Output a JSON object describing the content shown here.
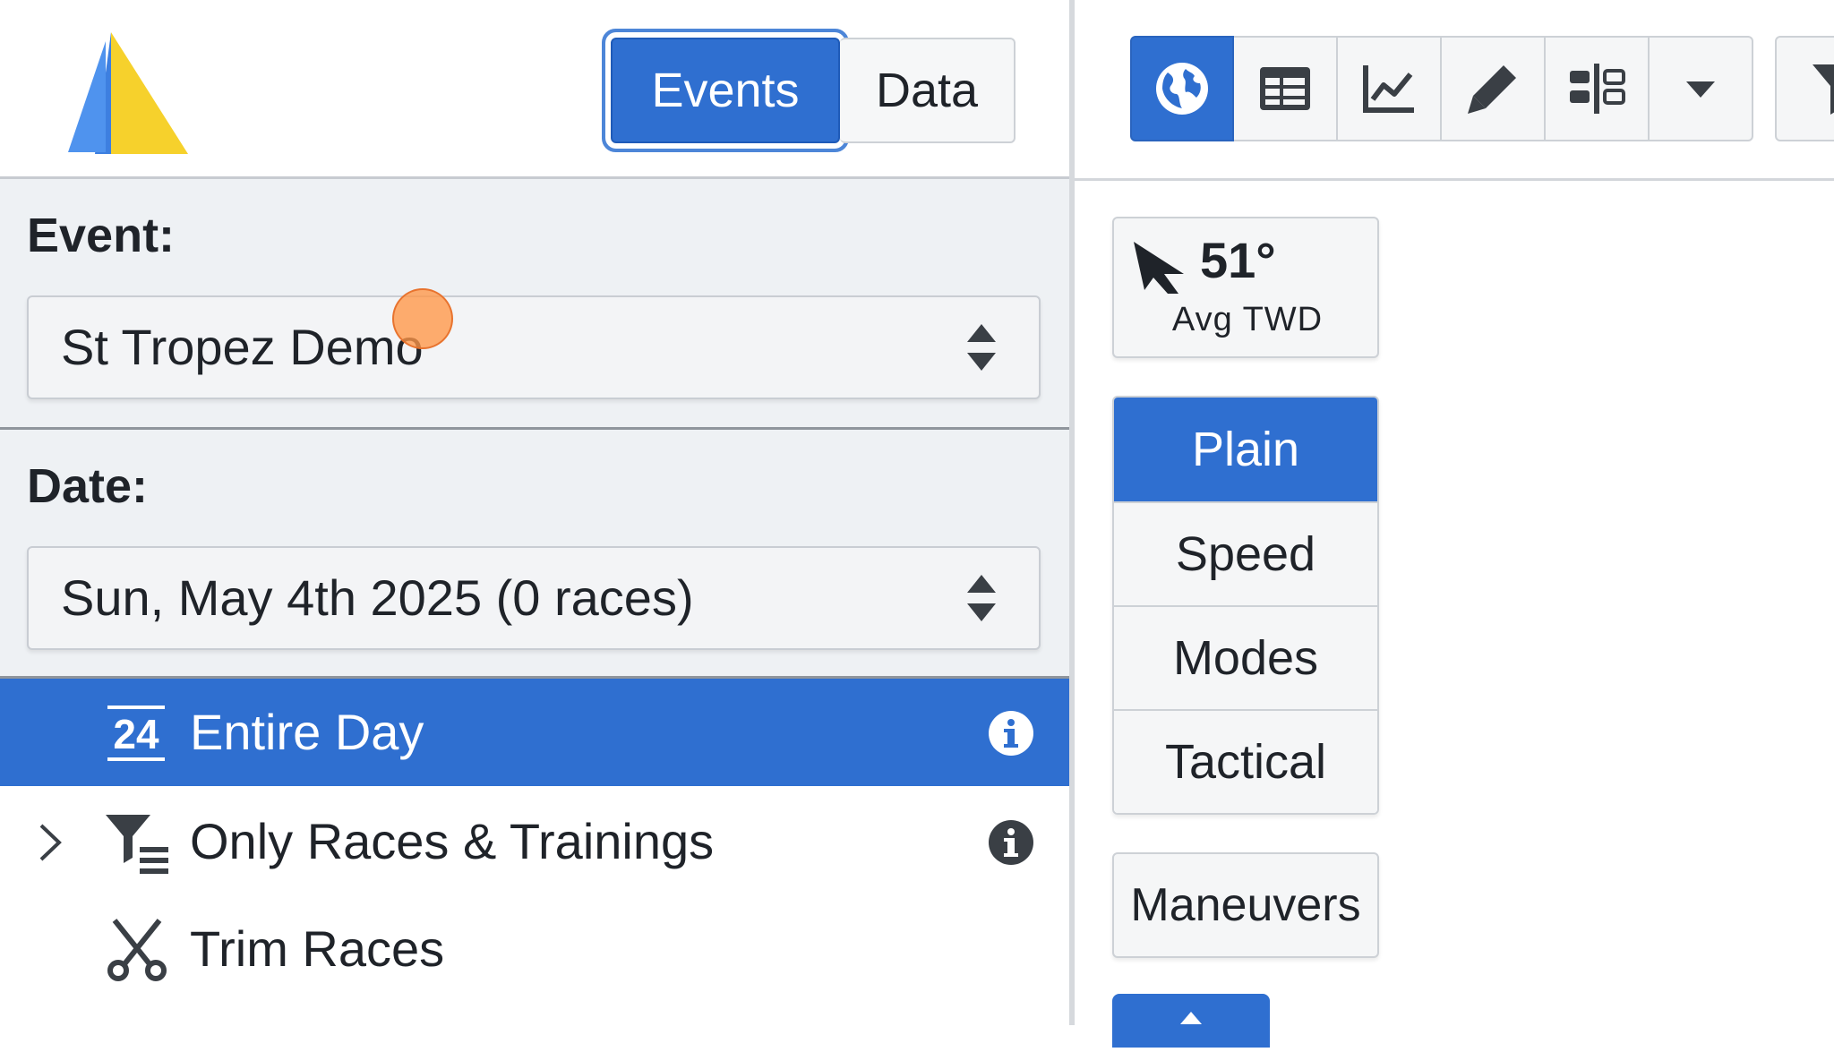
{
  "header": {
    "mode_toggle": {
      "events_label": "Events",
      "data_label": "Data",
      "active": "Events"
    }
  },
  "event_selector": {
    "label": "Event:",
    "selected": "St Tropez Demo"
  },
  "date_selector": {
    "label": "Date:",
    "selected": "Sun, May 4th 2025 (0 races)"
  },
  "tree": {
    "items": [
      {
        "label": "Entire Day",
        "icon": "calendar-24-icon",
        "badge": "24",
        "selected": true,
        "info": true
      },
      {
        "label": "Only Races & Trainings",
        "icon": "filter-list-icon",
        "expandable": true,
        "info": true
      },
      {
        "label": "Trim Races",
        "icon": "scissors-icon"
      }
    ]
  },
  "toolbar": {
    "buttons": [
      {
        "name": "map-view",
        "icon": "globe-icon",
        "active": true
      },
      {
        "name": "table-view",
        "icon": "table-icon"
      },
      {
        "name": "chart-view",
        "icon": "line-chart-icon"
      },
      {
        "name": "edit",
        "icon": "pencil-icon"
      },
      {
        "name": "layout",
        "icon": "columns-icon"
      },
      {
        "name": "more",
        "icon": "caret-down-icon"
      }
    ]
  },
  "wind": {
    "value": "51°",
    "label": "Avg TWD",
    "icon": "wind-direction-arrow-icon"
  },
  "color_modes": {
    "options": [
      "Plain",
      "Speed",
      "Modes",
      "Tactical"
    ],
    "active": "Plain"
  },
  "maneuvers": {
    "label": "Maneuvers"
  },
  "colors": {
    "accent": "#2f6fd0",
    "panel_bg": "#eef1f4",
    "logo_blue": "#3d7fe0",
    "logo_yellow": "#f6d12c"
  }
}
